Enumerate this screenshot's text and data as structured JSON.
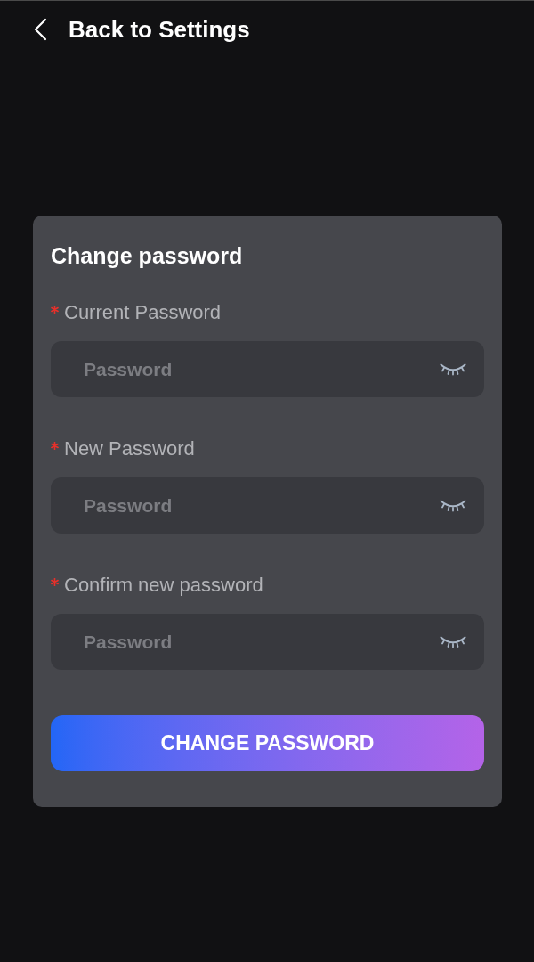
{
  "header": {
    "back_label": "Back to Settings"
  },
  "form": {
    "title": "Change password",
    "fields": [
      {
        "label": "Current Password",
        "required": true,
        "placeholder": "Password",
        "visible": false
      },
      {
        "label": "New Password",
        "required": true,
        "placeholder": "Password",
        "visible": false
      },
      {
        "label": "Confirm new password",
        "required": true,
        "placeholder": "Password",
        "visible": false
      }
    ],
    "submit": "CHANGE PASSWORD"
  }
}
